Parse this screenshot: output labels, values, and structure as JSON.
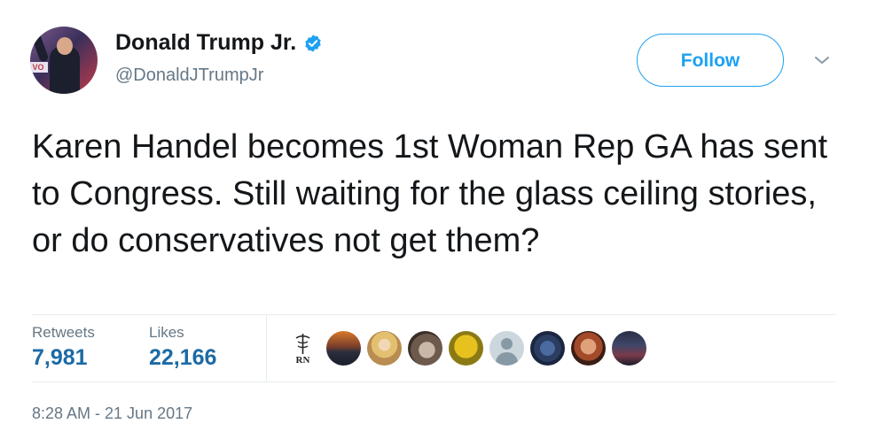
{
  "author": {
    "display_name": "Donald Trump Jr.",
    "handle": "@DonaldJTrumpJr",
    "verified": true,
    "avatar_sign_text": "VO"
  },
  "follow_label": "Follow",
  "tweet_text": "Karen Handel becomes 1st Woman Rep GA has sent to Congress. Still waiting for the glass ceiling stories, or do conservatives not get them?",
  "stats": {
    "retweets_label": "Retweets",
    "retweets_value": "7,981",
    "likes_label": "Likes",
    "likes_value": "22,166"
  },
  "likers": [
    {
      "name": "liker-rn-logo",
      "text": "RN"
    },
    {
      "name": "liker-sunset"
    },
    {
      "name": "liker-blonde"
    },
    {
      "name": "liker-dog"
    },
    {
      "name": "liker-yellow"
    },
    {
      "name": "liker-default"
    },
    {
      "name": "liker-tv"
    },
    {
      "name": "liker-man"
    },
    {
      "name": "liker-city"
    }
  ],
  "timestamp": "8:28 AM - 21 Jun 2017",
  "colors": {
    "accent": "#1da1f2",
    "stat_value": "#1c6aa5",
    "secondary_text": "#657786",
    "divider": "#e6ecf0"
  }
}
